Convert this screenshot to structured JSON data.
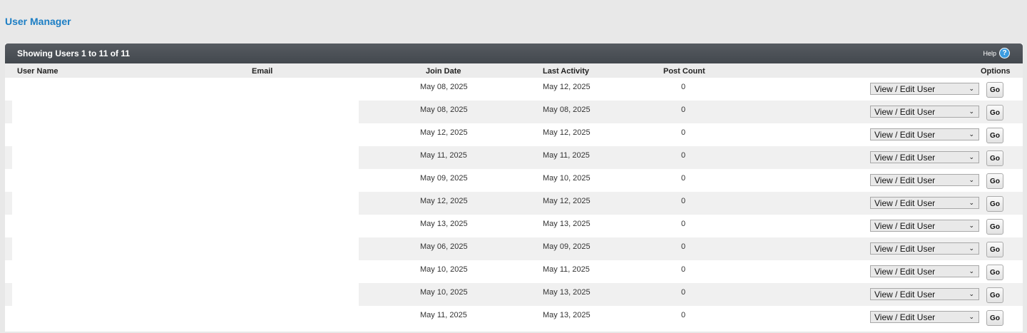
{
  "page": {
    "title": "User Manager"
  },
  "panel": {
    "title": "Showing Users 1 to 11 of 11",
    "help_label": "Help",
    "help_icon": "question-icon"
  },
  "columns": {
    "user_name": "User Name",
    "email": "Email",
    "join_date": "Join Date",
    "last_activity": "Last Activity",
    "post_count": "Post Count",
    "options": "Options"
  },
  "option_label": "View / Edit User",
  "go_label": "Go",
  "rows": [
    {
      "user_name": "",
      "email": "",
      "join_date": "May 08, 2025",
      "last_activity": "May 12, 2025",
      "post_count": "0"
    },
    {
      "user_name": "",
      "email": "",
      "join_date": "May 08, 2025",
      "last_activity": "May 08, 2025",
      "post_count": "0"
    },
    {
      "user_name": "",
      "email": "",
      "join_date": "May 12, 2025",
      "last_activity": "May 12, 2025",
      "post_count": "0"
    },
    {
      "user_name": "",
      "email": "",
      "join_date": "May 11, 2025",
      "last_activity": "May 11, 2025",
      "post_count": "0"
    },
    {
      "user_name": "",
      "email": "",
      "join_date": "May 09, 2025",
      "last_activity": "May 10, 2025",
      "post_count": "0"
    },
    {
      "user_name": "",
      "email": "",
      "join_date": "May 12, 2025",
      "last_activity": "May 12, 2025",
      "post_count": "0"
    },
    {
      "user_name": "",
      "email": "",
      "join_date": "May 13, 2025",
      "last_activity": "May 13, 2025",
      "post_count": "0"
    },
    {
      "user_name": "",
      "email": "",
      "join_date": "May 06, 2025",
      "last_activity": "May 09, 2025",
      "post_count": "0"
    },
    {
      "user_name": "",
      "email": "",
      "join_date": "May 10, 2025",
      "last_activity": "May 11, 2025",
      "post_count": "0"
    },
    {
      "user_name": "",
      "email": "",
      "join_date": "May 10, 2025",
      "last_activity": "May 13, 2025",
      "post_count": "0"
    },
    {
      "user_name": "",
      "email": "",
      "join_date": "May 11, 2025",
      "last_activity": "May 13, 2025",
      "post_count": "0"
    }
  ]
}
